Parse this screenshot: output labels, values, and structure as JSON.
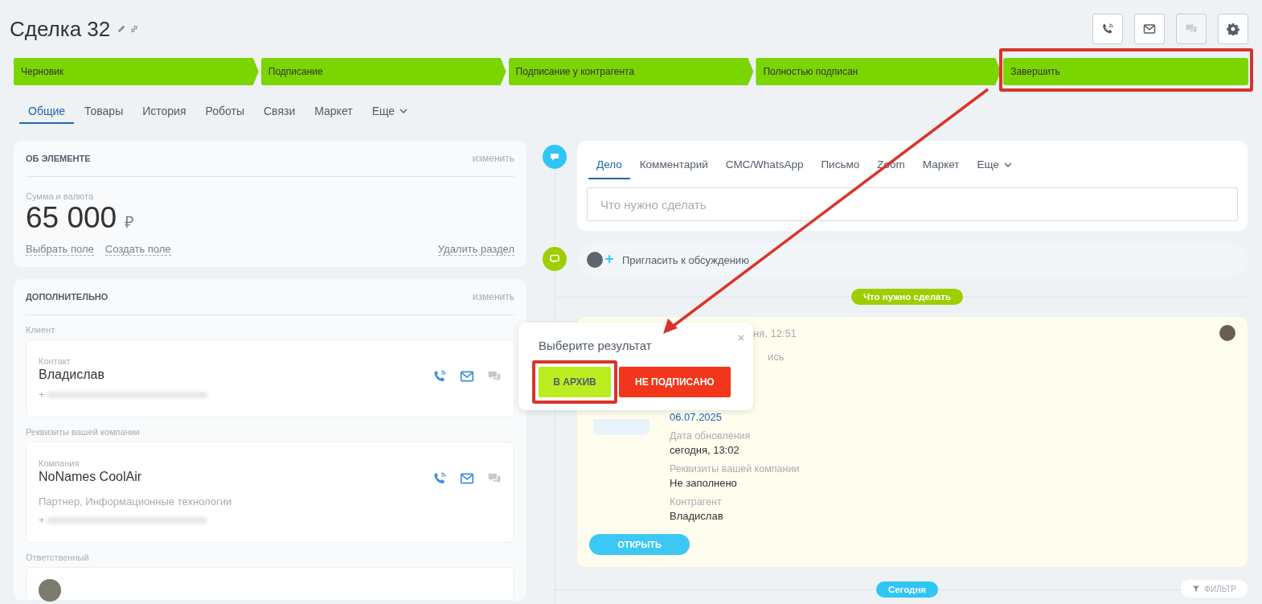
{
  "title": "Сделка 32",
  "header_buttons": [
    {
      "kind": "phone",
      "disabled": false
    },
    {
      "kind": "mail",
      "disabled": false
    },
    {
      "kind": "chat",
      "disabled": true
    },
    {
      "kind": "settings",
      "disabled": false
    }
  ],
  "stages": [
    {
      "label": "Черновик",
      "highlighted": false
    },
    {
      "label": "Подписание",
      "highlighted": false
    },
    {
      "label": "Подписание у контрагента",
      "highlighted": false
    },
    {
      "label": "Полностью подписан",
      "highlighted": false
    },
    {
      "label": "Завершить",
      "highlighted": true
    }
  ],
  "tabs": [
    {
      "label": "Общие",
      "selected": true
    },
    {
      "label": "Товары",
      "selected": false
    },
    {
      "label": "История",
      "selected": false
    },
    {
      "label": "Роботы",
      "selected": false
    },
    {
      "label": "Связи",
      "selected": false
    },
    {
      "label": "Маркет",
      "selected": false
    },
    {
      "label": "Еще",
      "selected": false,
      "dropdown": true
    }
  ],
  "about": {
    "heading": "ОБ ЭЛЕМЕНТЕ",
    "edit": "изменить",
    "field_label": "Сумма и валюта",
    "amount": "65 000",
    "currency": "₽",
    "links": [
      "Выбрать поле",
      "Создать поле"
    ],
    "delete": "Удалить раздел"
  },
  "extra": {
    "heading": "ДОПОЛНИТЕЛЬНО",
    "edit": "изменить",
    "sections": [
      {
        "label": "Клиент",
        "card": {
          "type_label": "Контакт",
          "name": "Владислав",
          "phone": "+"
        }
      },
      {
        "label": "Реквизиты вашей компании",
        "card": {
          "type_label": "Компания",
          "name": "NoNames CoolAir",
          "lines": [
            "Партнер, Информационные технологии"
          ],
          "phone": "+"
        }
      },
      {
        "label": "Ответственный"
      }
    ]
  },
  "composer": {
    "tabs": [
      {
        "label": "Дело",
        "selected": true
      },
      {
        "label": "Комментарий",
        "selected": false
      },
      {
        "label": "СМС/WhatsApp",
        "selected": false
      },
      {
        "label": "Письмо",
        "selected": false
      },
      {
        "label": "Zoom",
        "selected": false
      },
      {
        "label": "Маркет",
        "selected": false
      },
      {
        "label": "Еще",
        "selected": false,
        "dropdown": true
      }
    ],
    "placeholder": "Что нужно сделать"
  },
  "invite": "Пригласить к обсуждению",
  "todo_badge": "Что нужно сделать",
  "activity": {
    "time": "ня, 12:51",
    "subtitle": "ись",
    "date": "06.07.2025",
    "fields": [
      {
        "label": "Дата обновления",
        "value": "сегодня, 13:02"
      },
      {
        "label": "Реквизиты вашей компании",
        "value": "Не заполнено"
      },
      {
        "label": "Контрагент",
        "value": "Владислав"
      }
    ],
    "open_button": "ОТКРЫТЬ"
  },
  "today_badge": "Сегодня",
  "filter_button": "ФИЛЬТР",
  "popup": {
    "title": "Выберите результат",
    "buttons": [
      {
        "label": "В АРХИВ",
        "kind": "success",
        "highlighted": true
      },
      {
        "label": "НЕ ПОДПИСАНО",
        "kind": "failure",
        "highlighted": false
      }
    ]
  }
}
